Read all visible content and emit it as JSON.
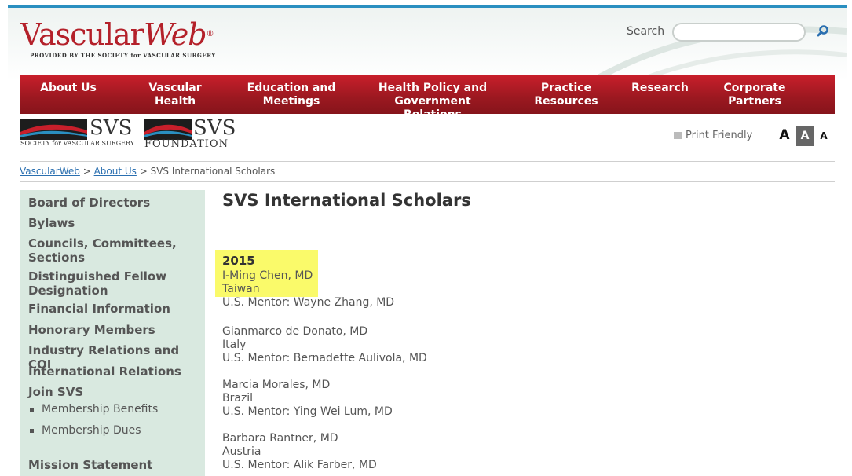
{
  "header": {
    "logo_main_1": "Vascular",
    "logo_main_2": "Web",
    "logo_reg": "®",
    "logo_sub": "PROVIDED BY THE SOCIETY for VASCULAR SURGERY",
    "search_label": "Search",
    "search_placeholder": ""
  },
  "nav": {
    "items": [
      {
        "label": "About Us"
      },
      {
        "label": "Vascular Health"
      },
      {
        "label": "Education and Meetings"
      },
      {
        "label": "Health Policy and Government Relations"
      },
      {
        "label": "Practice Resources"
      },
      {
        "label": "Research"
      },
      {
        "label": "Corporate Partners"
      }
    ]
  },
  "brand": {
    "svs": "SVS",
    "svs_sub": "SOCIETY for VASCULAR SURGERY",
    "foundation": "SVS",
    "foundation_sub": "FOUNDATION",
    "print_friendly": "Print Friendly",
    "font_sizes": [
      "A",
      "A",
      "A"
    ]
  },
  "breadcrumb": {
    "home": "VascularWeb",
    "sep": " > ",
    "parent": "About Us",
    "current": "SVS International Scholars"
  },
  "sidebar": {
    "items": [
      "Board of Directors",
      "Bylaws",
      "Councils, Committees, Sections",
      "Distinguished Fellow Designation",
      "Financial Information",
      "Honorary Members",
      "Industry Relations and COI",
      "International Relations",
      "Join SVS"
    ],
    "subitems": [
      "Membership Benefits",
      "Membership Dues"
    ],
    "last": "Mission Statement"
  },
  "main": {
    "title": "SVS International Scholars",
    "year": "2015",
    "scholars": [
      {
        "name": "I-Ming Chen, MD",
        "country": "Taiwan",
        "mentor": "U.S. Mentor: Wayne Zhang, MD"
      },
      {
        "name": "Gianmarco de Donato, MD",
        "country": "Italy",
        "mentor": "U.S. Mentor: Bernadette Aulivola, MD"
      },
      {
        "name": "Marcia Morales, MD",
        "country": "Brazil",
        "mentor": "U.S. Mentor: Ying Wei Lum, MD"
      },
      {
        "name": "Barbara Rantner, MD",
        "country": "Austria",
        "mentor": "U.S. Mentor: Alik Farber, MD"
      }
    ]
  },
  "colors": {
    "accent_red": "#b4212a",
    "top_blue": "#2a8fc0",
    "sidebar_bg": "#d9e9e0",
    "highlight": "#fafa6a"
  }
}
